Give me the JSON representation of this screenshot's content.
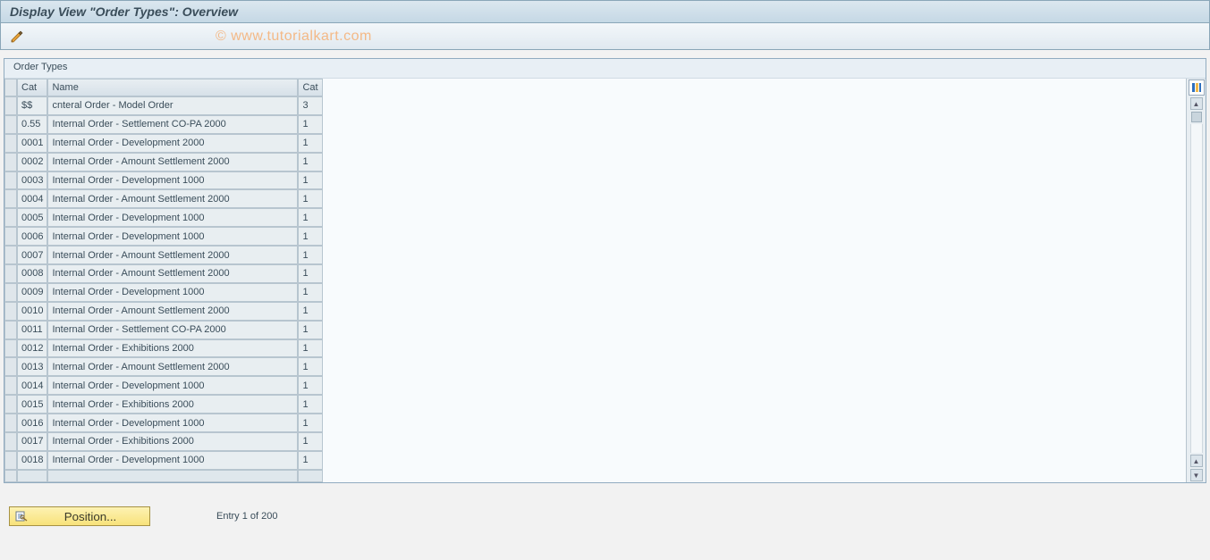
{
  "window": {
    "title": "Display View \"Order Types\": Overview"
  },
  "watermark": "© www.tutorialkart.com",
  "group": {
    "title": "Order Types"
  },
  "table": {
    "headers": {
      "sel": "",
      "cat1": "Cat",
      "name": "Name",
      "cat2": "Cat"
    },
    "rows": [
      {
        "cat1": "$$",
        "name": "cnteral Order - Model Order",
        "cat2": "3"
      },
      {
        "cat1": "0.55",
        "name": "Internal Order - Settlement CO-PA   2000",
        "cat2": "1"
      },
      {
        "cat1": "0001",
        "name": "Internal Order - Development         2000",
        "cat2": "1"
      },
      {
        "cat1": "0002",
        "name": "Internal Order - Amount Settlement  2000",
        "cat2": "1"
      },
      {
        "cat1": "0003",
        "name": "Internal Order - Development         1000",
        "cat2": "1"
      },
      {
        "cat1": "0004",
        "name": "Internal Order - Amount Settlement  2000",
        "cat2": "1"
      },
      {
        "cat1": "0005",
        "name": "Internal Order - Development         1000",
        "cat2": "1"
      },
      {
        "cat1": "0006",
        "name": "Internal Order - Development         1000",
        "cat2": "1"
      },
      {
        "cat1": "0007",
        "name": "Internal Order - Amount Settlement  2000",
        "cat2": "1"
      },
      {
        "cat1": "0008",
        "name": "Internal Order - Amount Settlement  2000",
        "cat2": "1"
      },
      {
        "cat1": "0009",
        "name": "Internal Order - Development         1000",
        "cat2": "1"
      },
      {
        "cat1": "0010",
        "name": "Internal Order - Amount Settlement  2000",
        "cat2": "1"
      },
      {
        "cat1": "0011",
        "name": "Internal Order - Settlement CO-PA   2000",
        "cat2": "1"
      },
      {
        "cat1": "0012",
        "name": "Internal Order - Exhibitions         2000",
        "cat2": "1"
      },
      {
        "cat1": "0013",
        "name": "Internal Order - Amount Settlement  2000",
        "cat2": "1"
      },
      {
        "cat1": "0014",
        "name": "Internal Order - Development         1000",
        "cat2": "1"
      },
      {
        "cat1": "0015",
        "name": "Internal Order - Exhibitions         2000",
        "cat2": "1"
      },
      {
        "cat1": "0016",
        "name": "Internal Order - Development         1000",
        "cat2": "1"
      },
      {
        "cat1": "0017",
        "name": "Internal Order - Exhibitions         2000",
        "cat2": "1"
      },
      {
        "cat1": "0018",
        "name": "Internal Order - Development         1000",
        "cat2": "1"
      }
    ]
  },
  "footer": {
    "position_button": "Position...",
    "entry_text": "Entry 1 of 200"
  }
}
